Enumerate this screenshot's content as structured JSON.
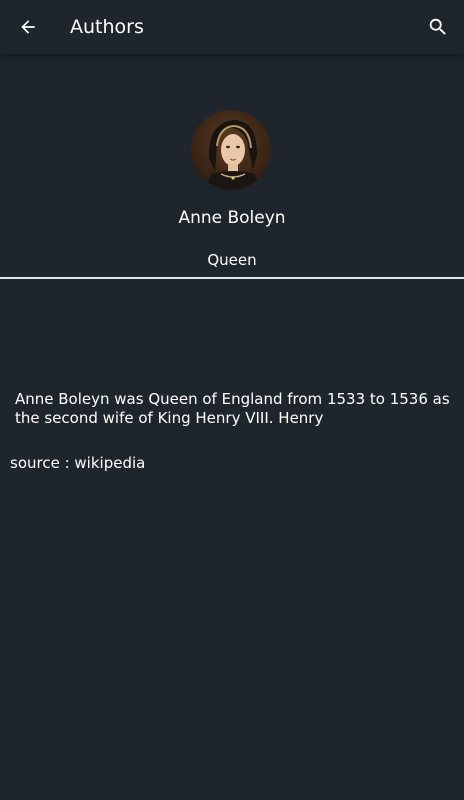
{
  "appbar": {
    "title": "Authors",
    "back_icon": "arrow-back-icon",
    "search_icon": "search-icon"
  },
  "author": {
    "name": "Anne Boleyn",
    "role": "Queen",
    "avatar": "portrait-avatar"
  },
  "content": {
    "bio": "Anne Boleyn was Queen of England from 1533 to 1536 as the second wife of King Henry VIII. Henry",
    "source": "source : wikipedia"
  },
  "colors": {
    "background": "#1f252d",
    "text": "#ffffff",
    "divider": "#e6e6e6"
  }
}
